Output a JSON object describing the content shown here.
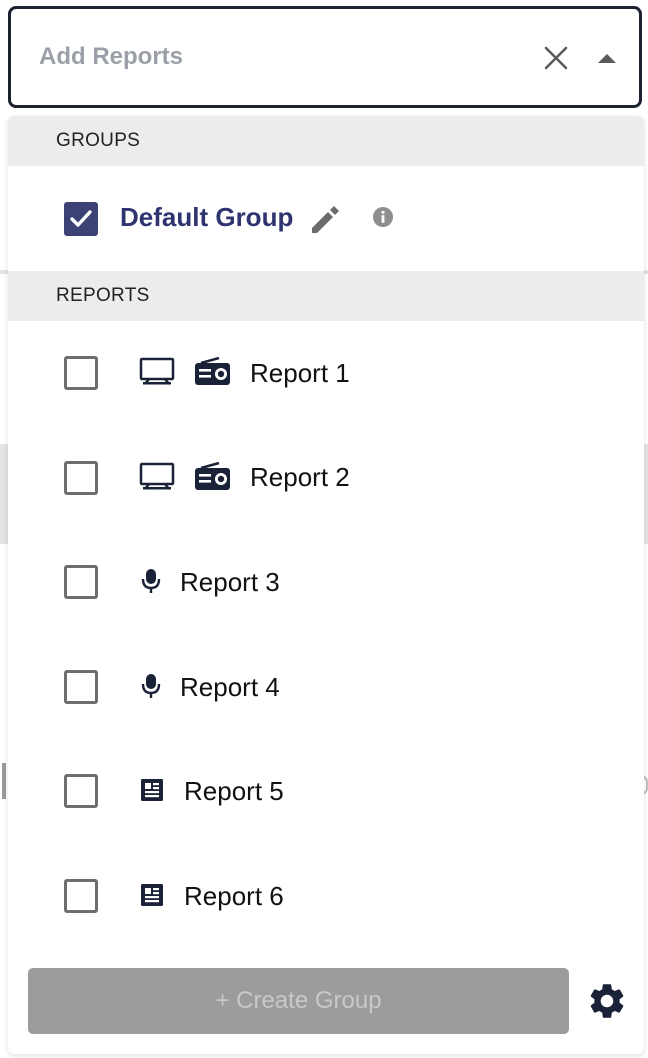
{
  "select": {
    "placeholder": "Add Reports",
    "clear_icon": "close-icon",
    "toggle_icon": "caret-up-icon"
  },
  "groups_section": {
    "header": "GROUPS",
    "items": [
      {
        "label": "Default Group",
        "checked": true,
        "icons": [
          "pencil-icon",
          "info-icon"
        ]
      }
    ]
  },
  "reports_section": {
    "header": "REPORTS",
    "items": [
      {
        "label": "Report 1",
        "checked": false,
        "icons": [
          "tv-icon",
          "radio-icon"
        ]
      },
      {
        "label": "Report 2",
        "checked": false,
        "icons": [
          "tv-icon",
          "radio-icon"
        ]
      },
      {
        "label": "Report 3",
        "checked": false,
        "icons": [
          "microphone-icon"
        ]
      },
      {
        "label": "Report 4",
        "checked": false,
        "icons": [
          "microphone-icon"
        ]
      },
      {
        "label": "Report 5",
        "checked": false,
        "icons": [
          "newspaper-icon"
        ]
      },
      {
        "label": "Report 6",
        "checked": false,
        "icons": [
          "newspaper-icon"
        ]
      }
    ]
  },
  "footer": {
    "create_label": "+ Create Group",
    "settings_icon": "gear-icon"
  },
  "colors": {
    "accent": "#3c4274",
    "group_text": "#2f3471",
    "select_border": "#1c2130",
    "section_bg": "#ececec",
    "disabled_button": "#9c9c9c"
  }
}
